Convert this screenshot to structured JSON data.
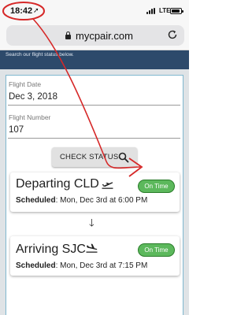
{
  "status_bar": {
    "time": "18:42",
    "network": "LTE"
  },
  "browser": {
    "url": "mycpair.com"
  },
  "banner": {
    "text": "Search our flight status below."
  },
  "form": {
    "flight_date_label": "Flight Date",
    "flight_date_value": "Dec 3, 2018",
    "flight_number_label": "Flight Number",
    "flight_number_value": "107",
    "check_status_label": "CHECK STATUS"
  },
  "departure": {
    "title": "Departing CLD",
    "status": "On Time",
    "scheduled_label": "Scheduled",
    "scheduled_value": ": Mon, Dec 3rd at 6:00 PM"
  },
  "arrival": {
    "title": "Arriving SJC",
    "status": "On Time",
    "scheduled_label": "Scheduled",
    "scheduled_value": ": Mon, Dec 3rd at 7:15 PM"
  },
  "colors": {
    "banner": "#2d4a6b",
    "on_time_badge": "#5cb85c",
    "annotation": "#d62828"
  },
  "icons": {
    "location": "location-arrow-icon",
    "signal": "signal-bars-icon",
    "battery": "battery-icon",
    "lock": "lock-icon",
    "reload": "reload-icon",
    "search": "search-icon",
    "departure": "plane-departure-icon",
    "arrival": "plane-arrival-icon",
    "arrow": "down-arrow-icon"
  }
}
